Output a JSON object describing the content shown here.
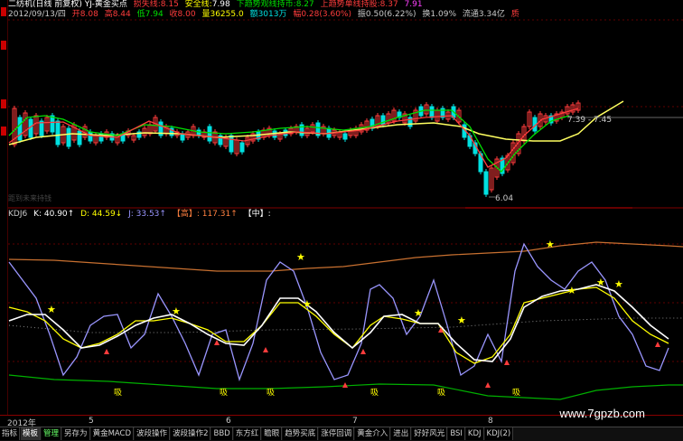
{
  "colors": {
    "red": "#ff3c3c",
    "green": "#00e000",
    "cyan": "#00e0e0",
    "yellow": "#ffff00",
    "white": "#ffffff",
    "magenta": "#ff40ff",
    "orange": "#c87030",
    "lavender": "#9a96ff",
    "grid": "#600000"
  },
  "header": {
    "title": "二纺机(日线 前复权) YJ-黄金买点",
    "stop_label": "损失线:",
    "stop_val": "8.15",
    "safe_label": "安全线:",
    "safe_val": "7.98",
    "down_label": "下趋势观线持币:",
    "down_val": "8.27",
    "up_label": "上趋势单线持股:",
    "up_val": "8.37",
    "right_val": "7.91"
  },
  "quote": {
    "date": "2012/09/13/四",
    "open": "开8.08",
    "high": "高8.44",
    "low": "低7.94",
    "close": "收8.00",
    "volume": "量36255.0",
    "amount": "额3013万",
    "change": "幅0.28(3.60%)",
    "swing": "振0.50(6.22%)",
    "turnover": "换1.09%",
    "float": "流通3.34亿",
    "extra": "质"
  },
  "main_chart": {
    "label_high": "7.39 - 7.45",
    "label_low": "6.04",
    "sub_note": "距到未来持钱"
  },
  "kdj": {
    "label": "KDJ6",
    "k": "K: 40.90↑",
    "d": "D: 44.59↓",
    "j": "J: 33.53↑",
    "high": "【高】: 117.31↑",
    "mid": "【中】:",
    "buy_label": "吸"
  },
  "dates": {
    "year": "2012年",
    "m5": "5",
    "m6": "6",
    "m7": "7",
    "m8": "8"
  },
  "tabs": [
    {
      "label": "指标",
      "state": ""
    },
    {
      "label": "模板",
      "state": "act"
    },
    {
      "label": "管理",
      "state": "green"
    },
    {
      "label": "另存为",
      "state": ""
    },
    {
      "label": "黄金MACD",
      "state": ""
    },
    {
      "label": "波段操作",
      "state": ""
    },
    {
      "label": "波段操作2",
      "state": ""
    },
    {
      "label": "BBD",
      "state": ""
    },
    {
      "label": "东方红",
      "state": ""
    },
    {
      "label": "瞻眼",
      "state": ""
    },
    {
      "label": "趋势买底",
      "state": ""
    },
    {
      "label": "涨停回调",
      "state": ""
    },
    {
      "label": "黄金介入",
      "state": ""
    },
    {
      "label": "进出",
      "state": ""
    },
    {
      "label": "好好风光",
      "state": ""
    },
    {
      "label": "BSI",
      "state": ""
    },
    {
      "label": "KDJ",
      "state": ""
    },
    {
      "label": "KDJ(2)",
      "state": ""
    }
  ],
  "watermark": "www.7gpzb.com"
}
